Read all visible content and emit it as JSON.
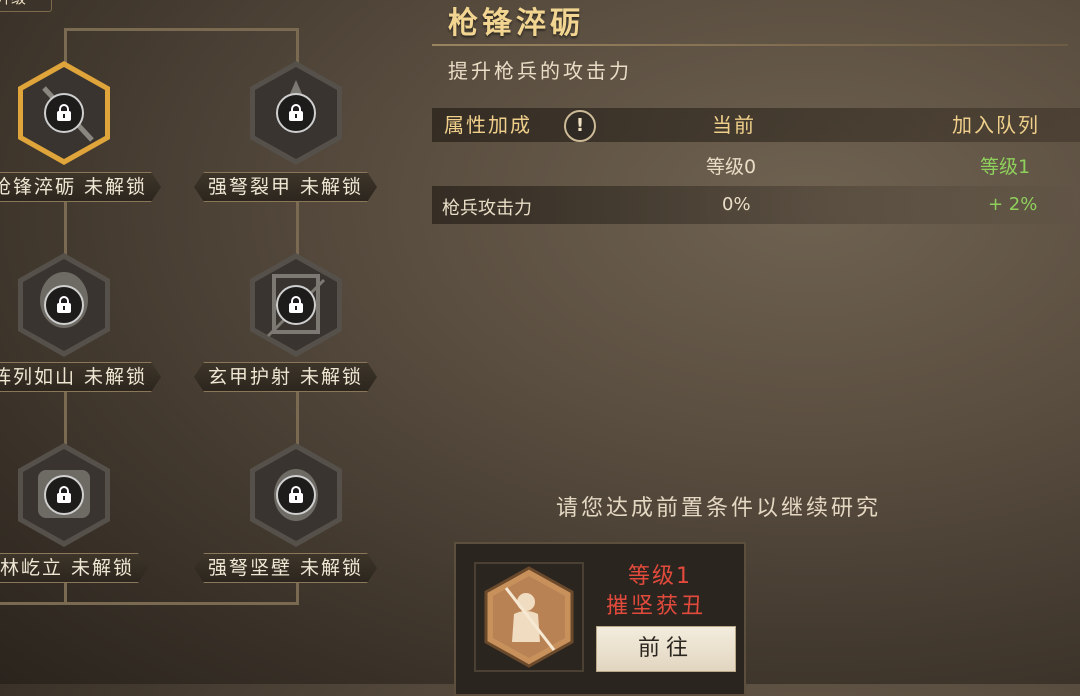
{
  "top_tab_label": "升级",
  "skill_tree": {
    "nodes": [
      {
        "label": "枪锋淬砺 未解锁",
        "icon": "spear-soldier-icon",
        "selected": true
      },
      {
        "label": "强弩裂甲 未解锁",
        "icon": "arrowhead-icon",
        "selected": false
      },
      {
        "label": "阵列如山 未解锁",
        "icon": "helmet-soldier-icon",
        "selected": false
      },
      {
        "label": "玄甲护射 未解锁",
        "icon": "shield-crossbow-icon",
        "selected": false
      },
      {
        "label": "林屹立 未解锁",
        "icon": "armor-icon",
        "selected": false
      },
      {
        "label": "强弩坚壁 未解锁",
        "icon": "archer-icon",
        "selected": false
      }
    ]
  },
  "detail": {
    "title": "枪锋淬砺",
    "description": "提升枪兵的攻击力",
    "table": {
      "col_attr": "属性加成",
      "col_current": "当前",
      "col_next": "加入队列",
      "level_current": "等级0",
      "level_next": "等级1",
      "rows": [
        {
          "name": "枪兵攻击力",
          "current": "0%",
          "next": "+ 2%"
        }
      ]
    },
    "hint": "请您达成前置条件以继续研究"
  },
  "requirement": {
    "level": "等级1",
    "name": "摧坚获丑",
    "go_label": "前往"
  },
  "colors": {
    "gold": "#f1d591",
    "green": "#8fcf5c",
    "red": "#e24a3c",
    "selected_border": "#e0a53a"
  }
}
